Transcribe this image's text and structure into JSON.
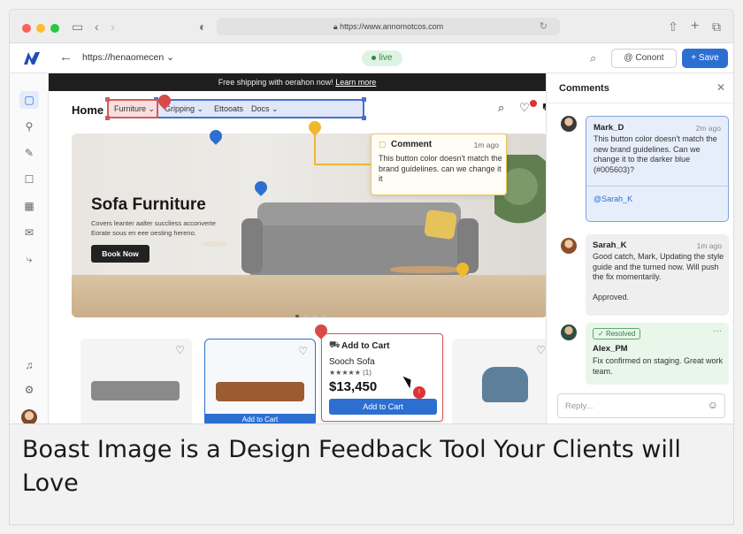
{
  "browser": {
    "url": "https://www.annomotcos.com",
    "colors": {
      "close": "#ff5f57",
      "minimize": "#febc2e",
      "zoom": "#28c840"
    }
  },
  "toolbar": {
    "address": "https://henaomecen",
    "live_label": "live",
    "contact_label": "Conont",
    "save_label": "Save"
  },
  "site": {
    "promo_text": "Free shipping with oerahon now!",
    "promo_link": "Learn more",
    "nav": {
      "home": "Home",
      "items": [
        "Furniture",
        "Gripping",
        "Ettooats",
        "Docs"
      ]
    },
    "hero": {
      "title": "Sofa Furniture",
      "subtitle": "Covers leanter aalter succliess acconverte Eorate sous en eee oesting hereno.",
      "button": "Book Now"
    },
    "card2_button": "Add to Cart",
    "popup": {
      "title": "Add to Cart",
      "product": "Sooch Sofa",
      "rating_stars": "★★★★★",
      "rating_count": "(1)",
      "rating_value": 4,
      "price": "$13,450",
      "button": "Add to Cart"
    },
    "cursor_badge": "!"
  },
  "bubble": {
    "title": "Comment",
    "time": "1m ago",
    "text": "This button color doesn't match the brand guidelines. can we change it it"
  },
  "panel": {
    "title": "Comments",
    "comments": [
      {
        "author": "Mark_D",
        "time": "2m ago",
        "text": "This button color doesn't match the new brand guidelines. Can we change it to the darker blue (#005603)?",
        "mention": "@Sarah_K"
      },
      {
        "author": "Sarah_K",
        "time": "1m ago",
        "text": "Good catch, Mark, Updating the style guide and the turned now. Will push the fix momentarily.",
        "extra": "Approved."
      },
      {
        "status": "Resolved",
        "author": "Alex_PM",
        "text": "Fix confirmed on staging. Great work team."
      }
    ],
    "reply_placeholder": "Reply..."
  },
  "caption": "Boast Image is a Design Feedback Tool Your Clients will Love"
}
